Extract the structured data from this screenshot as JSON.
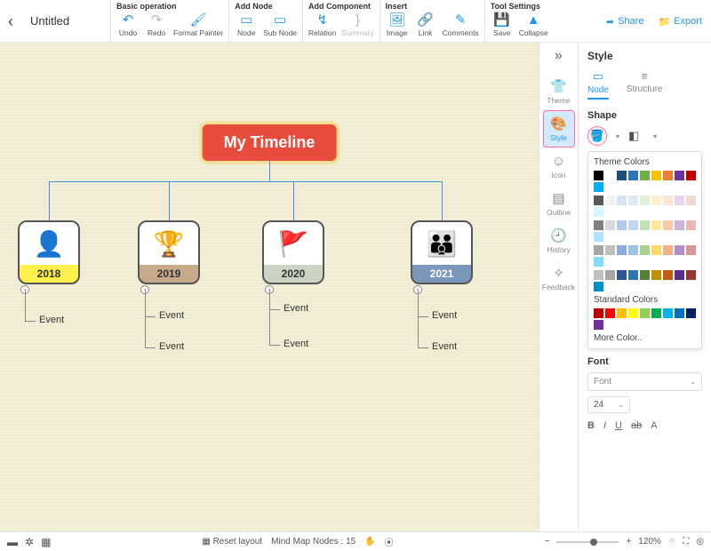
{
  "doc": {
    "title": "Untitled"
  },
  "toolbar": {
    "groups": {
      "basic": {
        "title": "Basic operation",
        "undo": "Undo",
        "redo": "Redo",
        "format": "Format Painter"
      },
      "addnode": {
        "title": "Add Node",
        "node": "Node",
        "subnode": "Sub Node"
      },
      "addcomp": {
        "title": "Add Component",
        "relation": "Relation",
        "summary": "Summary"
      },
      "insert": {
        "title": "Insert",
        "image": "Image",
        "link": "Link",
        "comments": "Comments"
      },
      "toolset": {
        "title": "Tool Settings",
        "save": "Save",
        "collapse": "Collapse"
      }
    },
    "share": "Share",
    "export": "Export"
  },
  "mindmap": {
    "title": "My Timeline",
    "years": {
      "y2018": "2018",
      "y2019": "2019",
      "y2020": "2020",
      "y2021": "2021"
    },
    "event": "Event"
  },
  "rail": {
    "theme": "Theme",
    "style": "Style",
    "icon": "Icon",
    "outline": "Outline",
    "history": "History",
    "feedback": "Feedback"
  },
  "panel": {
    "title": "Style",
    "tabs": {
      "node": "Node",
      "structure": "Structure"
    },
    "shape": "Shape",
    "themeColors": "Theme Colors",
    "standardColors": "Standard Colors",
    "moreColor": "More Color..",
    "font": "Font",
    "fontPlaceholder": "Font",
    "fontSize": "24",
    "theme_color_row": [
      "#000000",
      "#ffffff",
      "#1f4e79",
      "#2e75b6",
      "#70ad47",
      "#ffc000",
      "#ed7d31",
      "#7030a0",
      "#c00000",
      "#00b0f0"
    ],
    "theme_grey_rows": [
      [
        "#595959",
        "#f2f2f2",
        "#dae3f3",
        "#deebf7",
        "#e2f0d9",
        "#fff2cc",
        "#fbe5d6",
        "#e6d5ec",
        "#f2d7d5",
        "#d6f5ff"
      ],
      [
        "#7f7f7f",
        "#d9d9d9",
        "#b4c7e7",
        "#bdd7ee",
        "#c5e0b4",
        "#ffe699",
        "#f8cbad",
        "#ccb3d9",
        "#e6b8b7",
        "#aee6ff"
      ],
      [
        "#a6a6a6",
        "#bfbfbf",
        "#8faadc",
        "#9dc3e6",
        "#a9d18e",
        "#ffd966",
        "#f4b183",
        "#b38cc9",
        "#da9694",
        "#86d9ff"
      ],
      [
        "#bfbfbf",
        "#a6a6a6",
        "#2f5597",
        "#2e75b6",
        "#548235",
        "#bf9000",
        "#c55a11",
        "#5b2d91",
        "#963634",
        "#0091c2"
      ]
    ],
    "standard_row": [
      "#c00000",
      "#ff0000",
      "#ffc000",
      "#ffff00",
      "#92d050",
      "#00b050",
      "#00b0f0",
      "#0070c0",
      "#002060",
      "#7030a0"
    ]
  },
  "status": {
    "reset": "Reset layout",
    "nodes_label": "Mind Map Nodes :",
    "nodes_count": "15",
    "zoom": "120%"
  }
}
